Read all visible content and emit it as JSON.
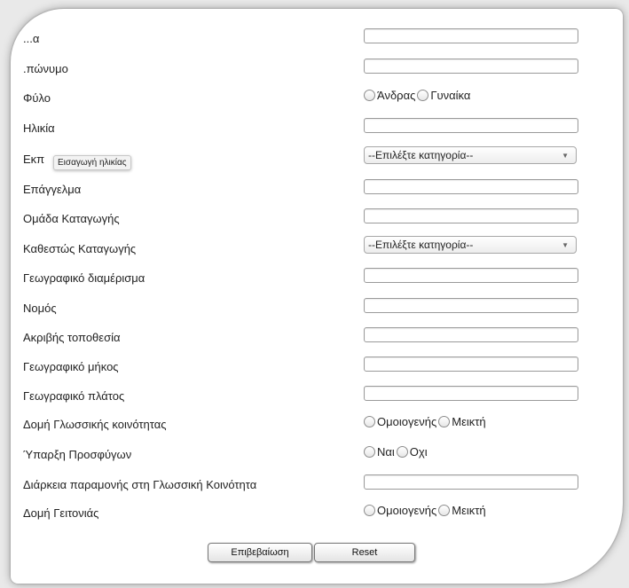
{
  "form": {
    "fields": [
      {
        "label": "Όνομα",
        "shown": "...α",
        "type": "text"
      },
      {
        "label": "Επώνυμο",
        "shown": ".πώνυμο",
        "type": "text"
      },
      {
        "label": "Φύλο",
        "type": "radio",
        "options": [
          "Άνδρας",
          "Γυναίκα"
        ]
      },
      {
        "label": "Ηλικία",
        "type": "text"
      },
      {
        "label": "Εκπαίδευση",
        "shown": "Εκπ",
        "type": "select",
        "value": "--Επιλέξτε κατηγορία--"
      },
      {
        "label": "Επάγγελμα",
        "type": "text"
      },
      {
        "label": "Ομάδα Καταγωγής",
        "type": "text"
      },
      {
        "label": "Καθεστώς Καταγωγής",
        "type": "select",
        "value": "--Επιλέξτε κατηγορία--"
      },
      {
        "label": "Γεωγραφικό διαμέρισμα",
        "type": "text"
      },
      {
        "label": "Νομός",
        "type": "text"
      },
      {
        "label": "Ακριβής τοποθεσία",
        "type": "text"
      },
      {
        "label": "Γεωγραφικό μήκος",
        "type": "text"
      },
      {
        "label": "Γεωγραφικό πλάτος",
        "type": "text"
      },
      {
        "label": "Δομή Γλωσσικής κοινότητας",
        "type": "radio",
        "options": [
          "Ομοιογενής",
          "Μεικτή"
        ]
      },
      {
        "label": "Ύπαρξη Προσφύγων",
        "type": "radio",
        "options": [
          "Ναι",
          "Οχι"
        ]
      },
      {
        "label": "Διάρκεια παραμονής στη Γλωσσική Κοινότητα",
        "type": "text"
      },
      {
        "label": "Δομή Γειτονιάς",
        "type": "radio",
        "options": [
          "Ομοιογενής",
          "Μεικτή"
        ]
      }
    ]
  },
  "tooltip": {
    "text": "Εισαγωγή ηλικίας"
  },
  "buttons": {
    "confirm_label": "Επιβεβαίωση",
    "reset_label": "Reset"
  },
  "icons": {
    "select_arrow": "chevron-down-icon"
  }
}
